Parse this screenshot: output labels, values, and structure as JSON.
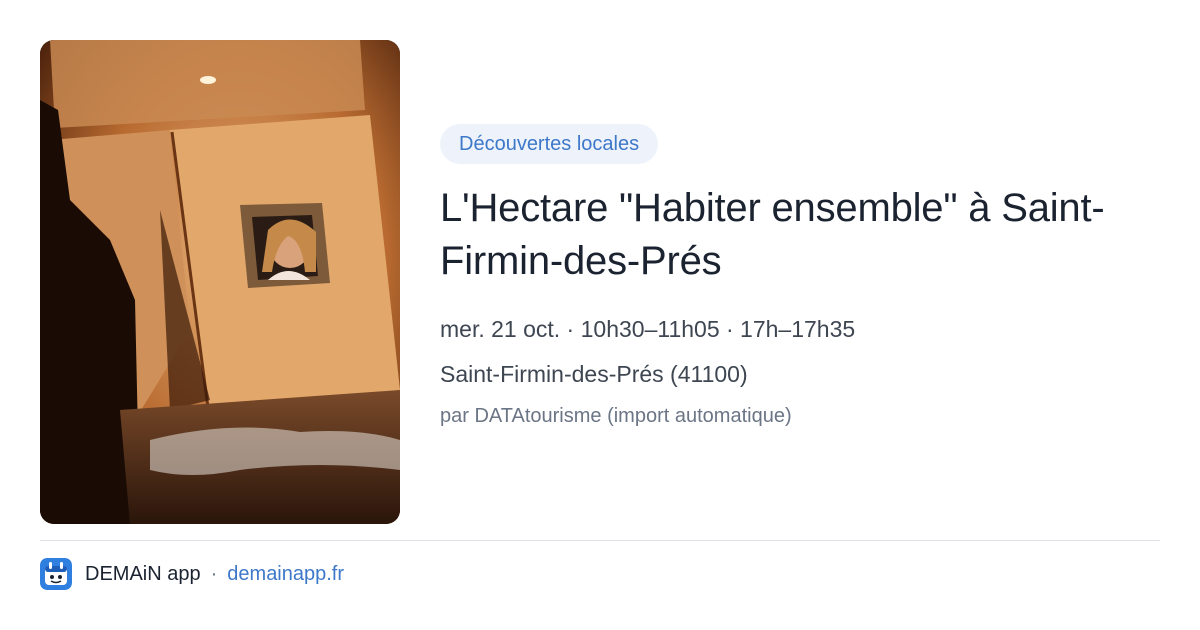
{
  "photo": {
    "alt": "Enfant regardant par la fenêtre d'une cabane en tissu éclairée"
  },
  "event": {
    "category": "Découvertes locales",
    "title": "L'Hectare \"Habiter ensemble\" à Saint-Firmin-des-Prés",
    "schedule": "mer. 21 oct. · 10h30–11h05 · 17h–17h35",
    "location": "Saint-Firmin-des-Prés (41100)",
    "source": "par DATAtourisme (import automatique)"
  },
  "footer": {
    "app_name": "DEMAiN app",
    "separator": "·",
    "domain": "demainapp.fr",
    "logo_icon": "demain-app-logo-icon"
  },
  "colors": {
    "accent": "#3d78c9",
    "tag_background": "#eef3fb",
    "title": "#1b2330",
    "muted": "#6b7585"
  }
}
